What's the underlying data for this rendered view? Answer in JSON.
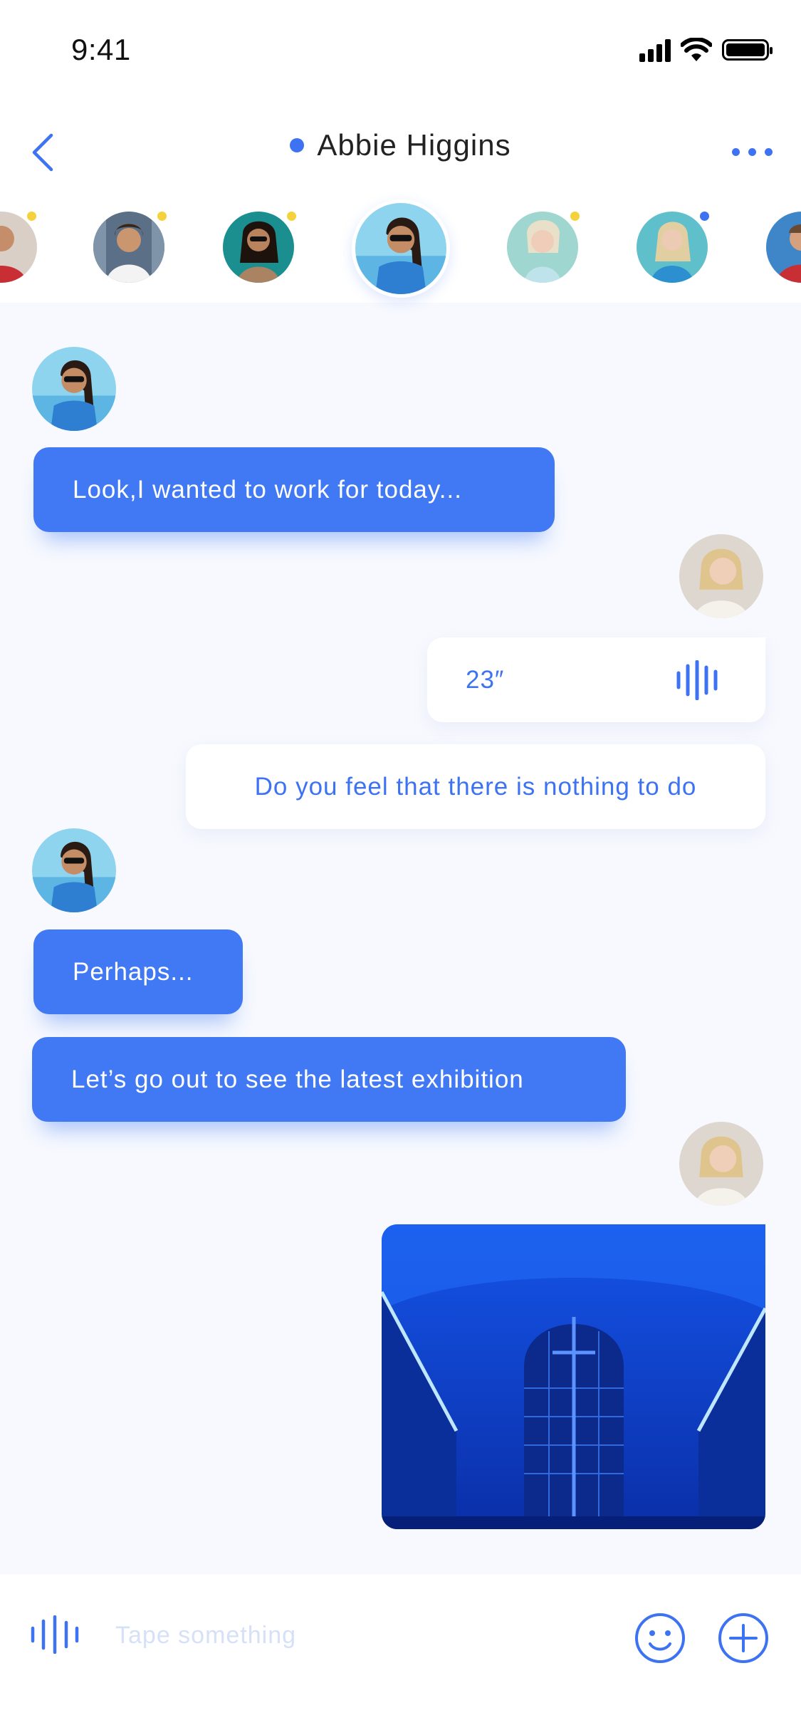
{
  "status_bar": {
    "time": "9:41"
  },
  "header": {
    "title": "Abbie Higgins",
    "online_color": "#3D73F2",
    "back_icon": "chevron-left-icon",
    "more_icon": "more-horizontal-icon"
  },
  "stories": [
    {
      "name": "contact-1",
      "status": "yellow"
    },
    {
      "name": "contact-2",
      "status": "yellow"
    },
    {
      "name": "contact-3",
      "status": "yellow"
    },
    {
      "name": "abbie-higgins",
      "status": "active"
    },
    {
      "name": "contact-5",
      "status": "yellow"
    },
    {
      "name": "contact-6",
      "status": "blue"
    },
    {
      "name": "contact-7",
      "status": "none"
    }
  ],
  "messages": {
    "m1": "Look,I wanted to work for today...",
    "voice_duration": "23″",
    "m3": "Do you feel that there is nothing to do",
    "m4": "Perhaps...",
    "m5": "Let’s go out to see the latest exhibition"
  },
  "input": {
    "placeholder": "Tape something",
    "voice_icon": "waveform-icon",
    "emoji_icon": "smile-icon",
    "add_icon": "plus-circle-icon"
  },
  "colors": {
    "accent": "#3D73F2",
    "bubble_in": "#4179F4",
    "chat_background": "#F7F9FE",
    "status_yellow": "#F5D23B"
  }
}
